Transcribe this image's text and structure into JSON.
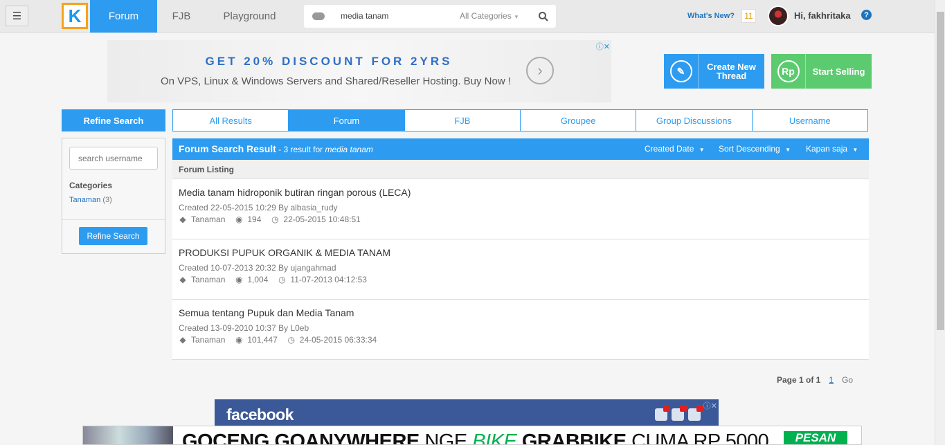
{
  "header": {
    "menu_icon": "hamburger-icon",
    "logo_letter": "K",
    "tabs": [
      {
        "label": "Forum",
        "active": true
      },
      {
        "label": "FJB",
        "active": false
      },
      {
        "label": "Playground",
        "active": false
      }
    ],
    "search": {
      "value": "media tanam",
      "category": "All Categories"
    },
    "whats_new": "What's New?",
    "notification_count": "11",
    "greeting": "Hi, fakhritaka",
    "help": "?"
  },
  "top_ad": {
    "headline": "GET 20% DISCOUNT FOR 2YRS",
    "subline": "On VPS, Linux & Windows Servers and Shared/Reseller Hosting. Buy Now !"
  },
  "actions": {
    "create_thread": "Create New Thread",
    "start_selling": "Start Selling",
    "sell_icon_text": "Rp"
  },
  "refine": {
    "header": "Refine Search",
    "username_placeholder": "search username",
    "categories_title": "Categories",
    "categories": [
      {
        "name": "Tanaman",
        "count": "(3)"
      }
    ],
    "button": "Refine Search"
  },
  "result_tabs": [
    {
      "label": "All Results",
      "active": false
    },
    {
      "label": "Forum",
      "active": true
    },
    {
      "label": "FJB",
      "active": false
    },
    {
      "label": "Groupee",
      "active": false
    },
    {
      "label": "Group Discussions",
      "active": false
    },
    {
      "label": "Username",
      "active": false
    }
  ],
  "results": {
    "title": "Forum Search Result",
    "count_text": " - 3 result for ",
    "query": "media tanam",
    "filters": [
      "Created Date",
      "Sort Descending",
      "Kapan saja"
    ],
    "listing_label": "Forum Listing",
    "threads": [
      {
        "title": "Media tanam hidroponik butiran ringan porous (LECA)",
        "meta": "Created 22-05-2015 10:29 By albasia_rudy",
        "tag": "Tanaman",
        "views": "194",
        "last": "22-05-2015 10:48:51"
      },
      {
        "title": "PRODUKSI PUPUK ORGANIK & MEDIA TANAM",
        "meta": "Created 10-07-2013 20:32 By ujangahmad",
        "tag": "Tanaman",
        "views": "1,004",
        "last": "11-07-2013 04:12:53"
      },
      {
        "title": "Semua tentang Pupuk dan Media Tanam",
        "meta": "Created 13-09-2010 10:37 By L0eb",
        "tag": "Tanaman",
        "views": "101,447",
        "last": "24-05-2015 06:33:34"
      }
    ]
  },
  "pager": {
    "label": "Page 1 of 1",
    "page": "1",
    "go": "Go"
  },
  "fb_ad": {
    "logo": "facebook"
  },
  "bottom_ad": {
    "text_a": "GOCENG GOANYWHERE",
    "text_b": "NGE",
    "text_c": "BIKE",
    "text_d": "GRABBIKE",
    "text_e": "CUMA RP 5000",
    "button": "PESAN"
  },
  "colors": {
    "accent": "#2d9cf0",
    "sell": "#5ccb6f",
    "brand_orange": "#f7a21b"
  }
}
